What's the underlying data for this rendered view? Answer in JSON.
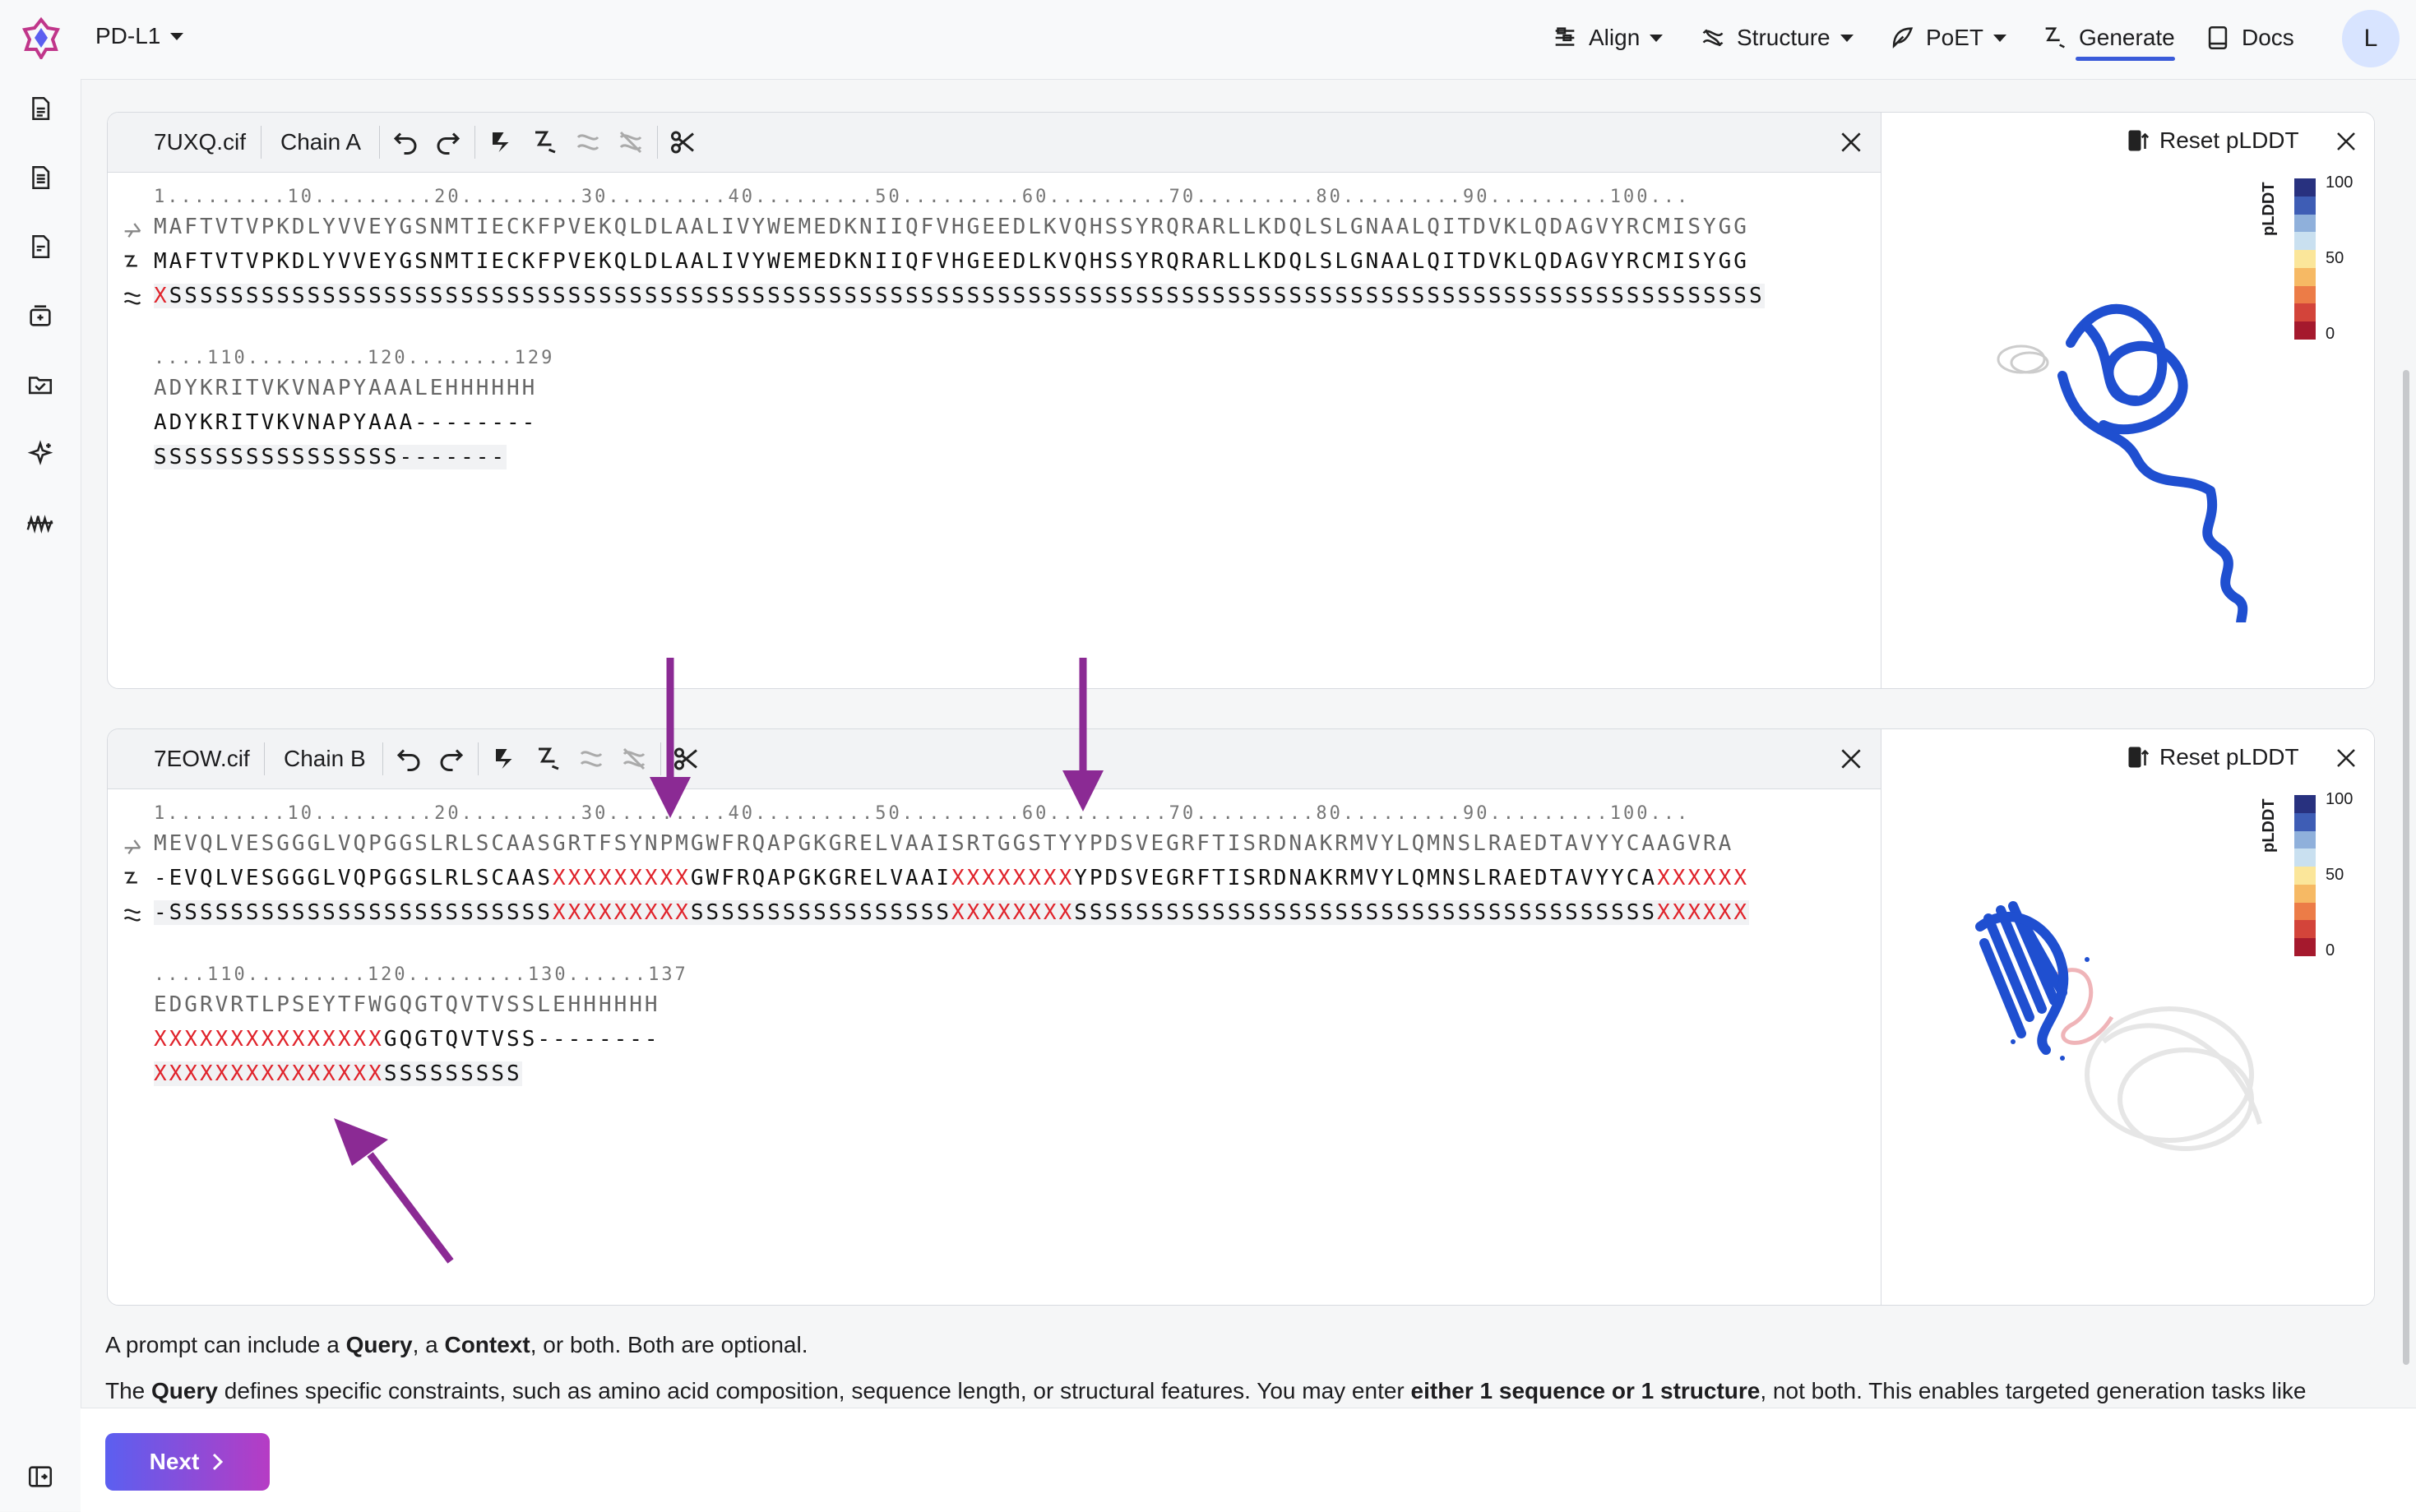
{
  "project": {
    "name": "PD-L1"
  },
  "nav": {
    "align": "Align",
    "structure": "Structure",
    "poet": "PoET",
    "generate": "Generate",
    "docs": "Docs",
    "avatar": "L"
  },
  "panels": [
    {
      "file": "7UXQ.cif",
      "chain": "Chain A",
      "reset_label": "Reset pLDDT",
      "plddt_title": "pLDDT",
      "ticks": {
        "max": "100",
        "mid": "50",
        "min": "0"
      },
      "ruler1": "1.........10.........20.........30.........40.........50.........60.........70.........80.........90.........100...",
      "query1": "MAFTVTVPKDLYVVEYGSNMTIECKFPVEKQLDLAALIVYWEMEDKNIIQFVHGEEDLKVQHSSYRQRARLLKDQLSLGNAALQITDVKLQDAGVYRCMISYGG",
      "seq1": "MAFTVTVPKDLYVVEYGSNMTIECKFPVEKQLDLAALIVYWEMEDKNIIQFVHGEEDLKVQHSSYRQRARLLKDQLSLGNAALQITDVKLQDAGVYRCMISYGG",
      "struct1_x": "X",
      "struct1": "SSSSSSSSSSSSSSSSSSSSSSSSSSSSSSSSSSSSSSSSSSSSSSSSSSSSSSSSSSSSSSSSSSSSSSSSSSSSSSSSSSSSSSSSSSSSSSSSSSSSSSSS",
      "ruler2": "....110.........120........129",
      "query2": "ADYKRITVKVNAPYAAALEHHHHHH",
      "seq2": "ADYKRITVKVNAPYAAA--------",
      "struct2": "SSSSSSSSSSSSSSSS-------"
    },
    {
      "file": "7EOW.cif",
      "chain": "Chain B",
      "reset_label": "Reset pLDDT",
      "plddt_title": "pLDDT",
      "ticks": {
        "max": "100",
        "mid": "50",
        "min": "0"
      },
      "ruler1": "1.........10.........20.........30.........40.........50.........60.........70.........80.........90.........100...",
      "query1": "MEVQLVESGGGLVQPGGSLRLSCAASGRTFSYNPMGWFRQAPGKGRELVAAISRTGGSTYYPDSVEGRFTISRDNAKRMVYLQMNSLRAEDTAVYYCAAGVRA",
      "seq1_a": "-EVQLVESGGGLVQPGGSLRLSCAAS",
      "seq1_x1": "XXXXXXXXX",
      "seq1_b": "GWFRQAPGKGRELVAAI",
      "seq1_x2": "XXXXXXXX",
      "seq1_c": "YPDSVEGRFTISRDNAKRMVYLQMNSLRAEDTAVYYCA",
      "seq1_x3": "XXXXXX",
      "struct1_a": "-SSSSSSSSSSSSSSSSSSSSSSSSS",
      "struct1_x1": "XXXXXXXXX",
      "struct1_b": "SSSSSSSSSSSSSSSSS",
      "struct1_x2": "XXXXXXXX",
      "struct1_c": "SSSSSSSSSSSSSSSSSSSSSSSSSSSSSSSSSSSSSS",
      "struct1_x3": "XXXXXX",
      "ruler2": "....110.........120.........130......137",
      "query2": "EDGRVRTLPSEYTFWGQGTQVTVSSLEHHHHHH",
      "seq2_x": "XXXXXXXXXXXXXXX",
      "seq2_b": "GQGTQVTVSS--------",
      "struct2_x": "XXXXXXXXXXXXXXX",
      "struct2_b": "SSSSSSSSS"
    }
  ],
  "description": {
    "line1_a": "A prompt can include a ",
    "line1_query": "Query",
    "line1_b": ", a ",
    "line1_context": "Context",
    "line1_c": ", or both. Both are optional.",
    "line2_a": "The ",
    "line2_query": "Query",
    "line2_b": " defines specific constraints, such as amino acid composition, sequence length, or structural features. You may enter ",
    "line2_bold": "either 1 sequence or 1 structure",
    "line2_c": ", not both. This enables targeted generation tasks like"
  },
  "footer": {
    "next_label": "Next"
  },
  "colors": {
    "accent": "#3a5bd9",
    "mutation": "#e0242c",
    "annotation_arrow": "#8b2a94",
    "structure_blue": "#1f4fd0"
  }
}
